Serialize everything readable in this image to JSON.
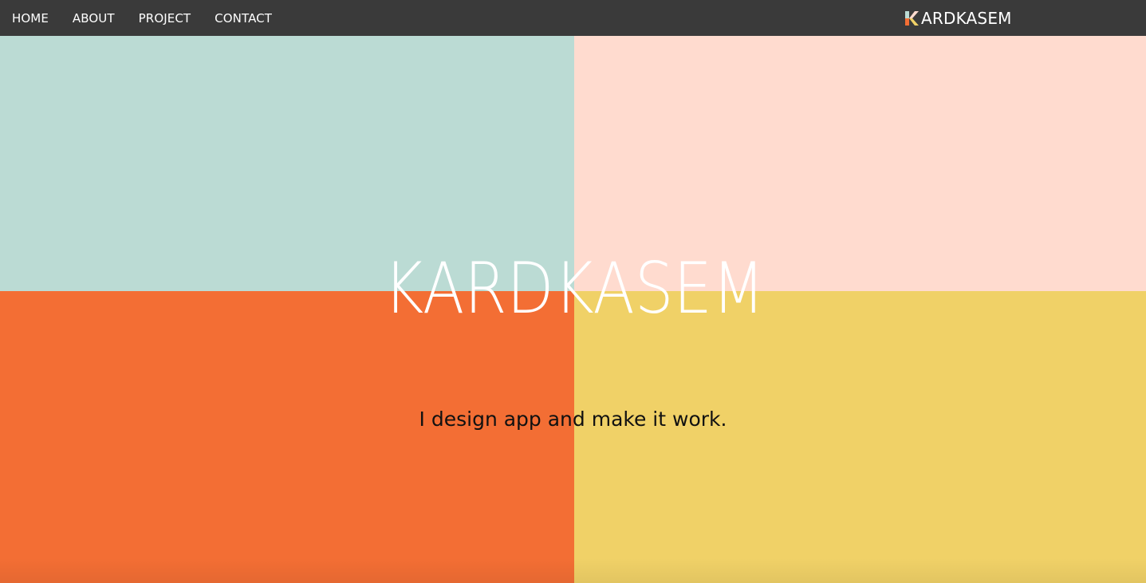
{
  "nav": {
    "items": [
      {
        "label": "HOME"
      },
      {
        "label": "ABOUT"
      },
      {
        "label": "PROJECT"
      },
      {
        "label": "CONTACT"
      }
    ],
    "brand": {
      "icon": "k-logo-icon",
      "text": "ARDKASEM"
    }
  },
  "hero": {
    "title": "KARDKASEM",
    "tagline": "I design app and make it work."
  },
  "colors": {
    "navbar": "#3a3a3a",
    "quad_top_left": "#bbdbd4",
    "quad_top_right": "#ffdbcf",
    "quad_bottom_left": "#f36e34",
    "quad_bottom_right": "#f0d167",
    "title": "#ffffff",
    "tagline": "#111111"
  }
}
